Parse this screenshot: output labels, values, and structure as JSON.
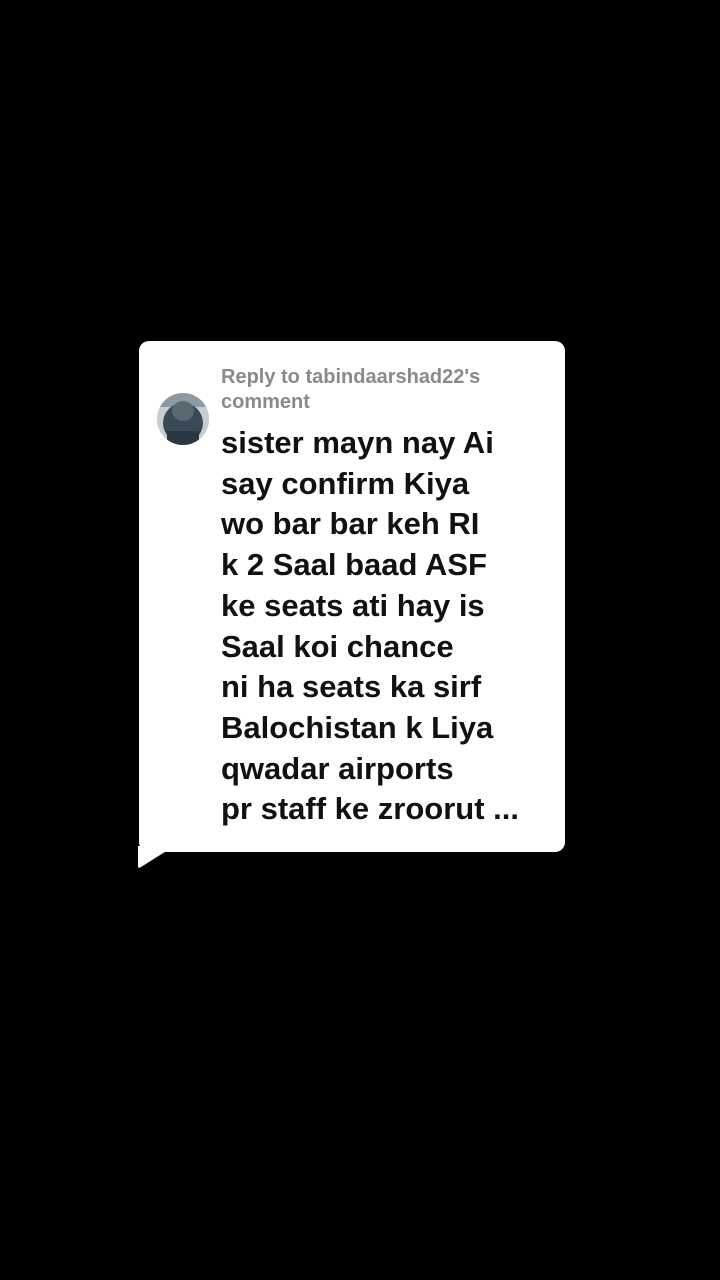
{
  "comment_card": {
    "reply_header": "Reply to tabindaarshad22's comment",
    "comment_lines": "sister mayn nay Ai\nsay confirm Kiya\nwo bar bar keh RI\nk 2 Saal baad ASF\nke seats ati hay is\nSaal koi chance\nni ha seats ka sirf\nBalochistan k Liya\nqwadar airports\npr staff ke zroorut ...",
    "avatar_icon": "user-avatar-icon"
  },
  "colors": {
    "background": "#000000",
    "bubble": "#ffffff",
    "header_text": "#8a8a8a",
    "body_text": "#111111"
  }
}
